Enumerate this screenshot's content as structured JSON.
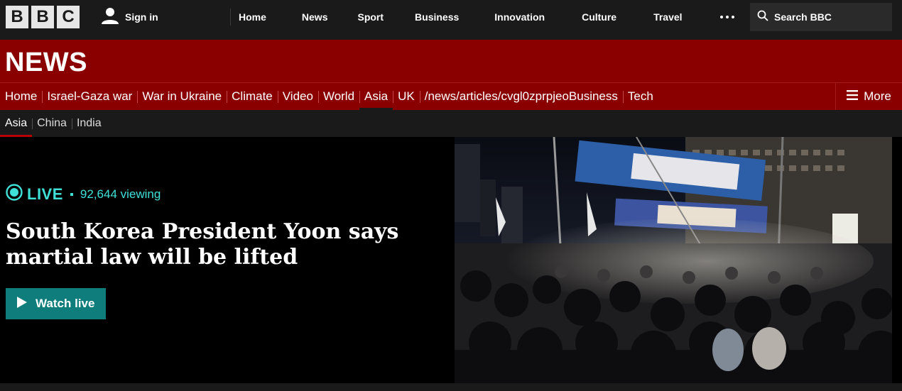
{
  "brand": {
    "letters": [
      "B",
      "B",
      "C"
    ]
  },
  "account": {
    "signin_label": "Sign in"
  },
  "top_nav": [
    "Home",
    "News",
    "Sport",
    "Business",
    "Innovation",
    "Culture",
    "Travel"
  ],
  "search": {
    "label": "Search BBC"
  },
  "masthead": {
    "title": "NEWS"
  },
  "section_nav": {
    "items": [
      "Home",
      "Israel-Gaza war",
      "War in Ukraine",
      "Climate",
      "Video",
      "World",
      "Asia",
      "UK",
      "/news/articles/cvgl0zprpjeoBusiness",
      "Tech"
    ],
    "active": "Asia",
    "more_label": "More"
  },
  "region_nav": {
    "items": [
      "Asia",
      "China",
      "India"
    ],
    "active": "Asia"
  },
  "hero": {
    "live_label": "LIVE",
    "viewers": "92,644 viewing",
    "headline": "South Korea President Yoon says martial law will be lifted",
    "watch_label": "Watch live",
    "live_color": "#3fe0d8",
    "button_color": "#0f7d7c"
  },
  "colors": {
    "brand_red": "#8a0000",
    "bar_dark": "#1a1a1a"
  }
}
